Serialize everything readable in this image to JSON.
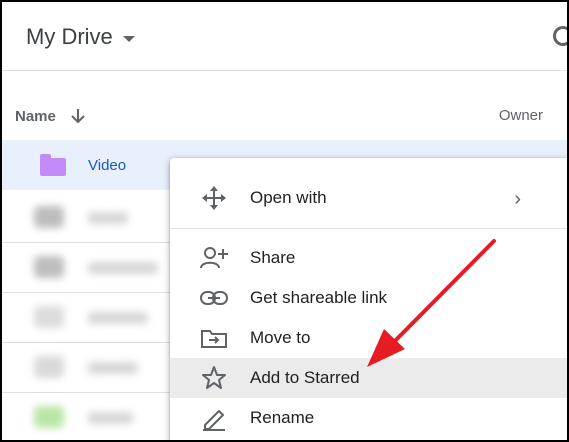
{
  "header": {
    "title": "My Drive"
  },
  "columns": {
    "name": "Name",
    "owner": "Owner"
  },
  "rows": [
    {
      "name": "Video"
    }
  ],
  "context_menu": {
    "items": [
      {
        "label": "Open with",
        "icon": "open-with-icon"
      },
      {
        "label": "Share",
        "icon": "person-add-icon"
      },
      {
        "label": "Get shareable link",
        "icon": "link-icon"
      },
      {
        "label": "Move to",
        "icon": "move-to-folder-icon"
      },
      {
        "label": "Add to Starred",
        "icon": "star-icon"
      },
      {
        "label": "Rename",
        "icon": "pencil-icon"
      }
    ]
  },
  "colors": {
    "accent": "#1a56c6",
    "folder": "#c58af9",
    "selection": "#e8f0fe",
    "highlight": "#ebebeb",
    "arrow": "#e51c23"
  }
}
